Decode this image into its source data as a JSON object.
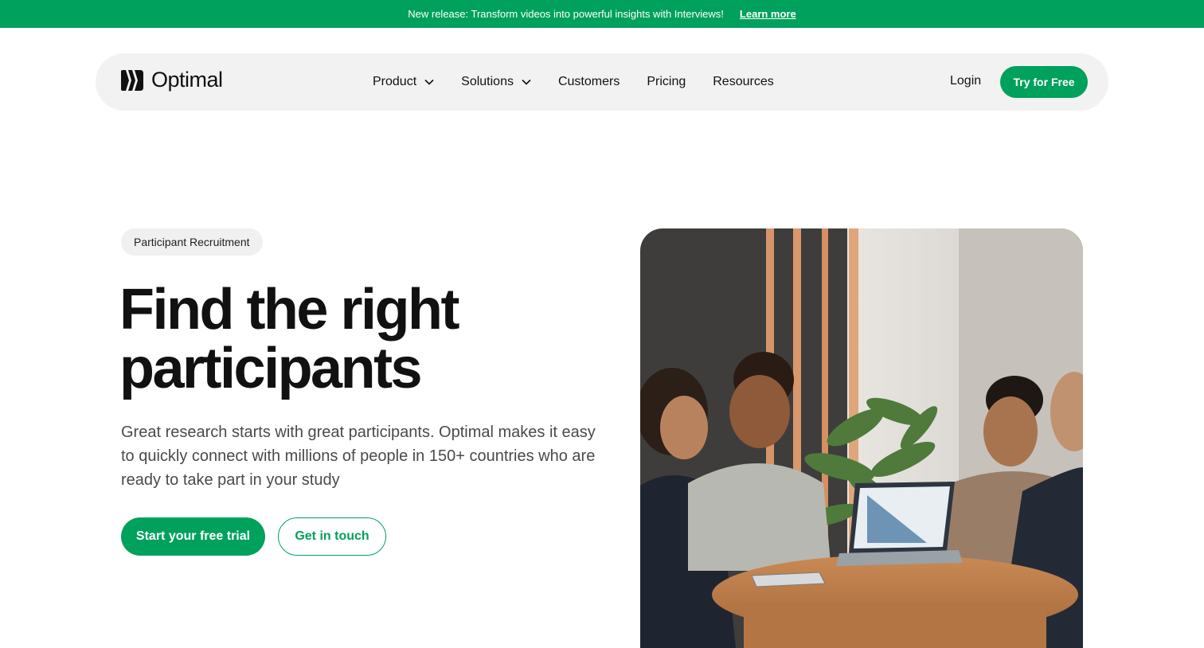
{
  "banner": {
    "text": "New release: Transform videos into powerful insights with Interviews!",
    "link": "Learn more"
  },
  "nav": {
    "brand": "Optimal",
    "items": [
      {
        "label": "Product",
        "icon": "chevron-down-icon"
      },
      {
        "label": "Solutions",
        "icon": "chevron-down-icon"
      },
      {
        "label": "Customers"
      },
      {
        "label": "Pricing"
      },
      {
        "label": "Resources"
      }
    ],
    "login": "Login",
    "cta": "Try for Free"
  },
  "hero": {
    "tag": "Participant Recruitment",
    "title_line1": "Find the right",
    "title_line2": "participants",
    "description": "Great research starts with great participants. Optimal makes it easy to quickly connect with millions of people in 150+ countries who are ready to take part in your study",
    "primary_button": "Start your free trial",
    "secondary_button": "Get in touch"
  },
  "colors": {
    "brand_green": "#00a15c",
    "nav_background": "#f2f2f2",
    "text": "#111111"
  }
}
